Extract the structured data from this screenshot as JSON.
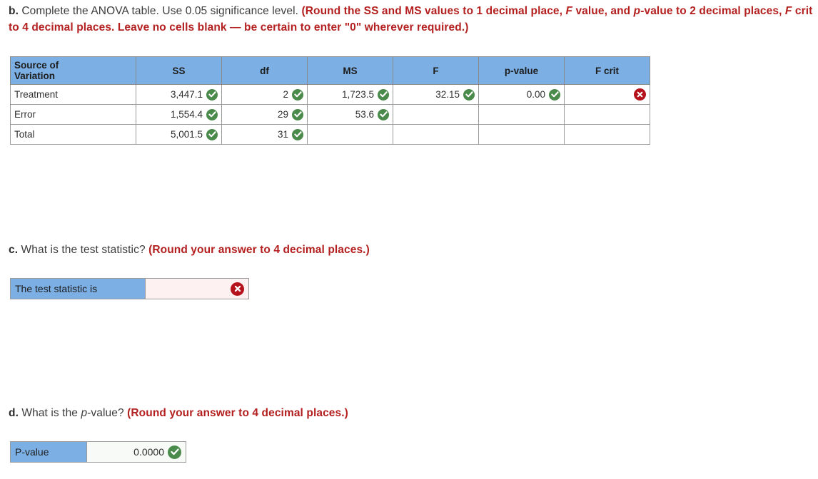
{
  "questions": {
    "b": {
      "marker": "b.",
      "text": " Complete the ANOVA table. Use 0.05 significance level. ",
      "instruction_1": "(Round the SS and MS values to 1 decimal place, ",
      "instruction_f1": "F",
      "instruction_2": " value, and ",
      "instruction_p1": "p",
      "instruction_3": "-value to 2 decimal places, ",
      "instruction_f2": "F",
      "instruction_4": " crit to 4 decimal places. Leave no cells blank — be certain to enter \"0\" wherever required.)"
    },
    "c": {
      "marker": "c.",
      "text": " What is the test statistic? ",
      "instruction": "(Round your answer to 4 decimal places.)"
    },
    "d": {
      "marker": "d.",
      "text_1": " What is the ",
      "text_p": "p",
      "text_2": "-value? ",
      "instruction": "(Round your answer to 4 decimal places.)"
    }
  },
  "anova_table": {
    "headers": [
      "Source of\nVariation",
      "SS",
      "df",
      "MS",
      "F",
      "p-value",
      "F crit"
    ],
    "header_source_line1": "Source of",
    "header_source_line2": "Variation",
    "header_ss": "SS",
    "header_df": "df",
    "header_ms": "MS",
    "header_f": "F",
    "header_pvalue": "p-value",
    "header_fcrit_f": "F",
    "header_fcrit_rest": " crit",
    "rows": [
      {
        "label": "Treatment",
        "ss": "3,447.1",
        "df": "2",
        "ms": "1,723.5",
        "f": "32.15",
        "pvalue": "0.00",
        "fcrit": ""
      },
      {
        "label": "Error",
        "ss": "1,554.4",
        "df": "29",
        "ms": "53.6",
        "f": "",
        "pvalue": "",
        "fcrit": ""
      },
      {
        "label": "Total",
        "ss": "5,001.5",
        "df": "31",
        "ms": "",
        "f": "",
        "pvalue": "",
        "fcrit": ""
      }
    ]
  },
  "answer_c": {
    "label": "The test statistic is",
    "value": "",
    "status": "incorrect",
    "status_icon": "x-circle-icon"
  },
  "answer_d": {
    "label_p": "P",
    "label_rest": "-value",
    "value": "0.0000",
    "status": "correct",
    "status_icon": "check-circle-icon"
  },
  "colors": {
    "header_blue": "#7cafe4",
    "correct_green": "#4a8a4a",
    "incorrect_red": "#b5121b",
    "instruction_red": "#b42020",
    "correct_cell_bg": "#f6faf6",
    "incorrect_cell_bg": "#fdf1f1",
    "border_grey": "#9a9a9a"
  }
}
